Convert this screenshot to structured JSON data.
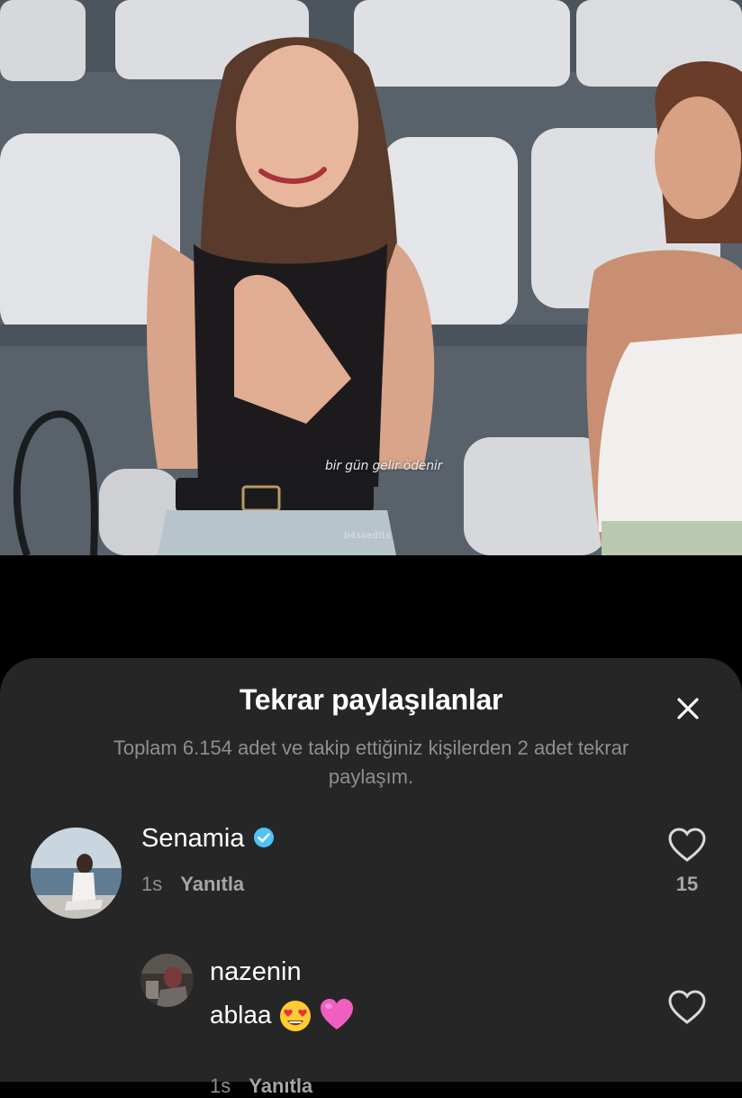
{
  "video": {
    "subtitle": "bir gün gelir ödenir",
    "watermark": "b4ssedits"
  },
  "sheet": {
    "title": "Tekrar paylaşılanlar",
    "description": "Toplam 6.154 adet ve takip ettiğiniz kişilerden 2 adet tekrar paylaşım."
  },
  "comments": [
    {
      "username": "Senamia",
      "verified": true,
      "time": "1s",
      "reply_label": "Yanıtla",
      "likes": "15",
      "icon": "heart-outline-icon"
    },
    {
      "username": "nazenin",
      "text": "ablaa",
      "emojis": [
        "heart-eyes-emoji",
        "pink-heart-emoji"
      ],
      "time": "1s",
      "reply_label": "Yanıtla",
      "icon": "heart-outline-icon"
    }
  ],
  "colors": {
    "sheet_bg": "#262627",
    "verified": "#4fc3f7",
    "secondary_text": "#8e8e93"
  }
}
